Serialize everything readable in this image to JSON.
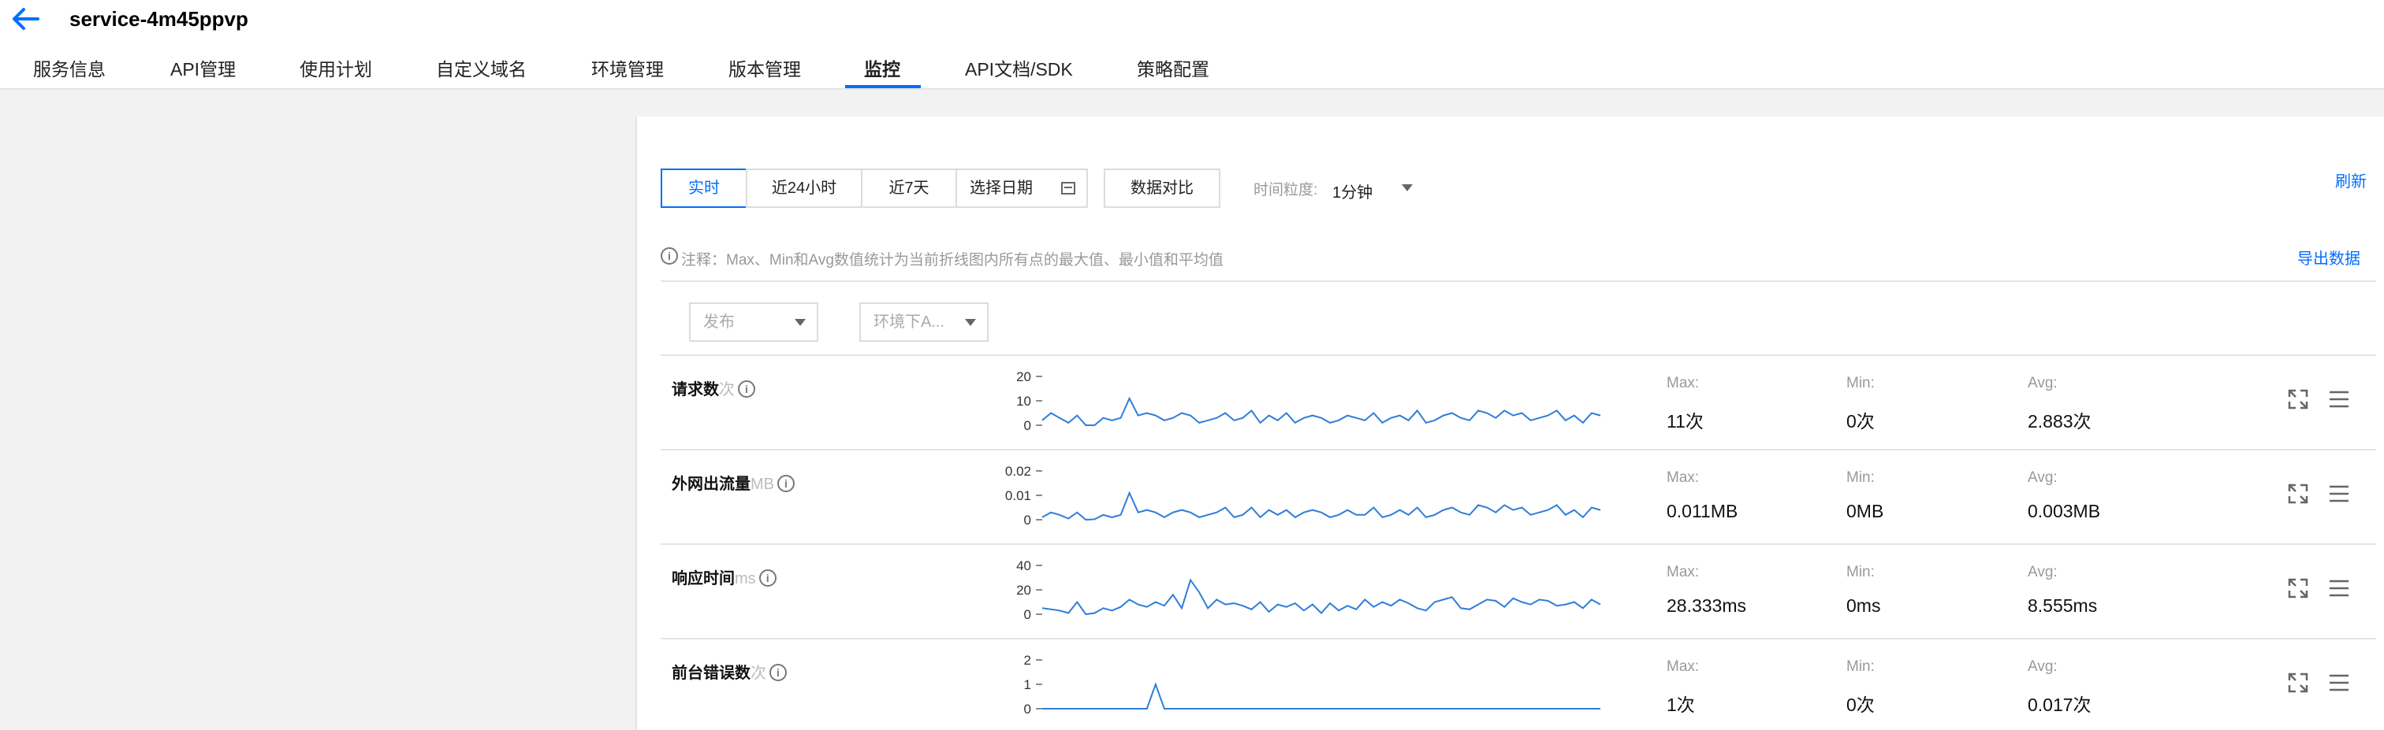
{
  "header": {
    "title": "service-4m45ppvp",
    "tabs": [
      {
        "label": "服务信息",
        "active": false
      },
      {
        "label": "API管理",
        "active": false
      },
      {
        "label": "使用计划",
        "active": false
      },
      {
        "label": "自定义域名",
        "active": false
      },
      {
        "label": "环境管理",
        "active": false
      },
      {
        "label": "版本管理",
        "active": false
      },
      {
        "label": "监控",
        "active": true
      },
      {
        "label": "API文档/SDK",
        "active": false
      },
      {
        "label": "策略配置",
        "active": false
      }
    ]
  },
  "toolbar": {
    "time_buttons": [
      {
        "label": "实时",
        "active": true
      },
      {
        "label": "近24小时",
        "active": false
      },
      {
        "label": "近7天",
        "active": false
      }
    ],
    "date_picker_label": "选择日期",
    "compare_label": "数据对比",
    "granularity_label": "时间粒度:",
    "granularity_value": "1分钟",
    "refresh_label": "刷新"
  },
  "note": {
    "text": "注释：Max、Min和Avg数值统计为当前折线图内所有点的最大值、最小值和平均值",
    "export_label": "导出数据"
  },
  "filters": {
    "release_placeholder": "发布",
    "env_placeholder": "环境下A..."
  },
  "colors": {
    "accent": "#006eff",
    "line": "#2f7ed8"
  },
  "metrics": [
    {
      "name": "请求数",
      "unit": "次",
      "ticks": [
        "20",
        "10",
        "0"
      ],
      "max_label": "Max:",
      "max": "11次",
      "min_label": "Min:",
      "min": "0次",
      "avg_label": "Avg:",
      "avg": "2.883次",
      "chart_data": {
        "type": "line",
        "ylim": [
          0,
          20
        ],
        "values": [
          2,
          5,
          3,
          1,
          4,
          0,
          0,
          3,
          2,
          3,
          11,
          4,
          5,
          4,
          2,
          3,
          5,
          4,
          1,
          2,
          3,
          5,
          2,
          3,
          6,
          1,
          4,
          2,
          5,
          1,
          3,
          4,
          3,
          1,
          2,
          4,
          3,
          2,
          5,
          1,
          3,
          4,
          2,
          6,
          1,
          2,
          4,
          5,
          3,
          2,
          6,
          5,
          3,
          6,
          4,
          5,
          2,
          3,
          4,
          6,
          2,
          4,
          1,
          5,
          4
        ]
      }
    },
    {
      "name": "外网出流量",
      "unit": "MB",
      "ticks": [
        "0.02",
        "0.01",
        "0"
      ],
      "max_label": "Max:",
      "max": "0.011MB",
      "min_label": "Min:",
      "min": "0MB",
      "avg_label": "Avg:",
      "avg": "0.003MB",
      "chart_data": {
        "type": "line",
        "ylim": [
          0,
          0.02
        ],
        "values": [
          0.001,
          0.003,
          0.002,
          0.0005,
          0.003,
          0,
          0.0002,
          0.002,
          0.001,
          0.002,
          0.011,
          0.003,
          0.004,
          0.003,
          0.001,
          0.003,
          0.004,
          0.003,
          0.001,
          0.002,
          0.003,
          0.005,
          0.001,
          0.002,
          0.005,
          0.001,
          0.004,
          0.002,
          0.004,
          0.001,
          0.003,
          0.004,
          0.003,
          0.001,
          0.002,
          0.004,
          0.002,
          0.002,
          0.005,
          0.001,
          0.002,
          0.004,
          0.002,
          0.005,
          0.001,
          0.002,
          0.004,
          0.005,
          0.003,
          0.002,
          0.006,
          0.005,
          0.003,
          0.006,
          0.004,
          0.005,
          0.002,
          0.003,
          0.004,
          0.006,
          0.002,
          0.004,
          0.001,
          0.005,
          0.004
        ]
      }
    },
    {
      "name": "响应时间",
      "unit": "ms",
      "ticks": [
        "40",
        "20",
        "0"
      ],
      "max_label": "Max:",
      "max": "28.333ms",
      "min_label": "Min:",
      "min": "0ms",
      "avg_label": "Avg:",
      "avg": "8.555ms",
      "chart_data": {
        "type": "line",
        "ylim": [
          0,
          40
        ],
        "values": [
          5,
          4,
          3,
          1,
          10,
          0,
          1,
          5,
          3,
          6,
          12,
          8,
          6,
          10,
          7,
          16,
          5,
          28,
          18,
          5,
          12,
          8,
          9,
          7,
          4,
          10,
          2,
          8,
          6,
          9,
          3,
          8,
          1,
          9,
          3,
          7,
          4,
          12,
          6,
          10,
          7,
          12,
          9,
          5,
          3,
          10,
          12,
          14,
          5,
          4,
          8,
          12,
          11,
          6,
          13,
          10,
          8,
          12,
          11,
          7,
          8,
          10,
          5,
          12,
          8
        ]
      }
    },
    {
      "name": "前台错误数",
      "unit": "次",
      "ticks": [
        "2",
        "1",
        "0"
      ],
      "max_label": "Max:",
      "max": "1次",
      "min_label": "Min:",
      "min": "0次",
      "avg_label": "Avg:",
      "avg": "0.017次",
      "chart_data": {
        "type": "line",
        "ylim": [
          0,
          2
        ],
        "values": [
          0,
          0,
          0,
          0,
          0,
          0,
          0,
          0,
          0,
          0,
          0,
          0,
          0,
          1,
          0,
          0,
          0,
          0,
          0,
          0,
          0,
          0,
          0,
          0,
          0,
          0,
          0,
          0,
          0,
          0,
          0,
          0,
          0,
          0,
          0,
          0,
          0,
          0,
          0,
          0,
          0,
          0,
          0,
          0,
          0,
          0,
          0,
          0,
          0,
          0,
          0,
          0,
          0,
          0,
          0,
          0,
          0,
          0,
          0,
          0,
          0,
          0,
          0,
          0,
          0
        ]
      }
    }
  ]
}
